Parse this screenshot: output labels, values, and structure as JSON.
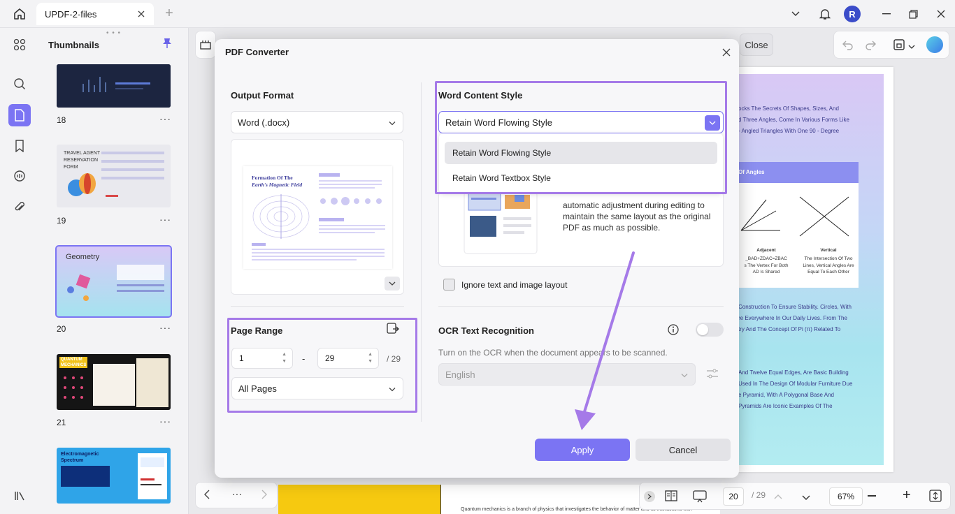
{
  "titlebar": {
    "tab_label": "UPDF-2-files",
    "avatar_initial": "R"
  },
  "thumbnails": {
    "title": "Thumbnails",
    "pages": [
      {
        "num": "18"
      },
      {
        "num": "19",
        "text_lines": [
          "TRAVEL AGENT",
          "RESERVATION",
          "FORM"
        ]
      },
      {
        "num": "20",
        "title": "Geometry"
      },
      {
        "num": "21",
        "text_lines": [
          "QUANTUM",
          "MECHANICS"
        ]
      },
      {
        "num": "",
        "text_lines": [
          "Electromagnetic",
          "Spectrum"
        ]
      }
    ],
    "more": "···"
  },
  "toolbar": {
    "close_label": "Close"
  },
  "dialog": {
    "title": "PDF Converter",
    "output_format": {
      "label": "Output Format",
      "value": "Word (.docx)"
    },
    "preview": {
      "title_lines": [
        "Formation Of The",
        "Earth's Magnetic Field"
      ]
    },
    "page_range": {
      "label": "Page Range",
      "from": "1",
      "to": "29",
      "total": "/ 29",
      "dash": "-",
      "selection": "All Pages"
    },
    "word_style": {
      "label": "Word Content Style",
      "value": "Retain Word Flowing Style",
      "options": [
        "Retain Word Flowing Style",
        "Retain Word Textbox Style"
      ],
      "description": "automatic adjustment during editing to maintain the same layout as the original PDF as much as possible."
    },
    "ignore_layout": {
      "label": "Ignore text and image layout",
      "checked": false
    },
    "ocr": {
      "label": "OCR Text Recognition",
      "hint": "Turn on the OCR when the document appears to be scanned.",
      "language": "English",
      "enabled": false
    },
    "apply_label": "Apply",
    "cancel_label": "Cancel"
  },
  "doc_right": {
    "lines_top": [
      "ocks The Secrets Of Shapes, Sizes, And",
      "d Three Angles, Come In Various Forms Like",
      "- Angled Triangles With One 90 - Degree"
    ],
    "section_heading": "Of Angles",
    "diagram_left_title": "Adjacent",
    "diagram_left_lines": [
      "_BAD+ZDAC=ZBAC",
      "s The Vertex For Both",
      "AD Is Shared"
    ],
    "diagram_right_title": "Vertical",
    "diagram_right_lines": [
      "The Intersection Of Two",
      "Lines, Vertical Angles Are",
      "Equal To Each Other"
    ],
    "lines_mid": [
      "Construction To Ensure Stability. Circles, With",
      "re Everywhere In Our Daily Lives. From The",
      "try And The Concept Of Pi (π) Related To"
    ],
    "lines_bottom": [
      "And Twelve Equal Edges, Are Basic Building",
      "Used In The Design Of Modular Furniture Due",
      "e Pyramid, With A Polygonal Base And",
      "Pyramids Are Iconic Examples Of The"
    ]
  },
  "bottom_doc_text": "Quantum mechanics is a branch of physics that investigates the behavior of matter and its interactions with",
  "statusbar": {
    "page_current": "20",
    "page_total": "/ 29",
    "zoom": "67%"
  },
  "colors": {
    "accent": "#7b74f3",
    "highlight": "#a57ae8"
  }
}
